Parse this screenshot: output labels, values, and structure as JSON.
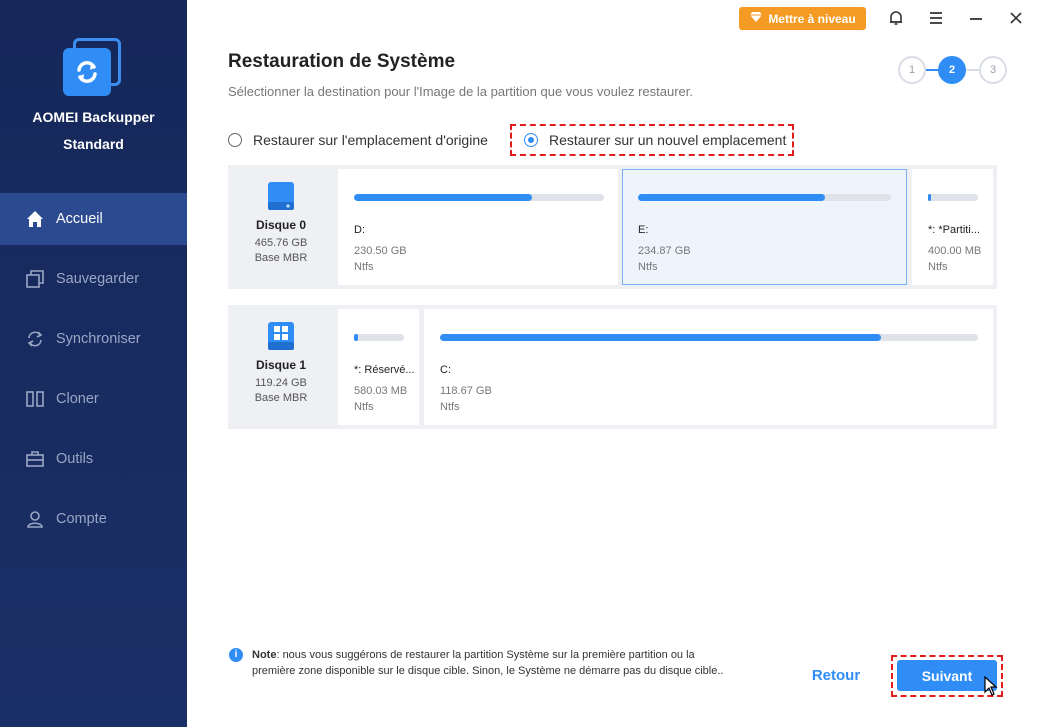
{
  "app": {
    "name": "AOMEI Backupper",
    "edition": "Standard"
  },
  "sidebar": {
    "items": [
      {
        "label": "Accueil",
        "icon": "home-icon",
        "active": true
      },
      {
        "label": "Sauvegarder",
        "icon": "backup-icon",
        "active": false
      },
      {
        "label": "Synchroniser",
        "icon": "sync-icon",
        "active": false
      },
      {
        "label": "Cloner",
        "icon": "clone-icon",
        "active": false
      },
      {
        "label": "Outils",
        "icon": "toolbox-icon",
        "active": false
      },
      {
        "label": "Compte",
        "icon": "user-icon",
        "active": false
      }
    ]
  },
  "topbar": {
    "upgrade_label": "Mettre à niveau",
    "icons": [
      "bell-icon",
      "menu-icon",
      "minimize-icon",
      "close-icon"
    ]
  },
  "page": {
    "title": "Restauration de Système",
    "subtitle": "Sélectionner la destination pour l'Image de la partition que vous voulez restaurer."
  },
  "stepper": {
    "steps": [
      "1",
      "2",
      "3"
    ],
    "current": 2
  },
  "options": {
    "original": "Restaurer sur l'emplacement d'origine",
    "new_location": "Restaurer sur un nouvel emplacement",
    "selected": "new_location"
  },
  "disks": [
    {
      "name": "Disque 0",
      "size": "465.76 GB",
      "type": "Base MBR",
      "partitions": [
        {
          "label": "D:",
          "size": "230.50 GB",
          "fs": "Ntfs",
          "used": 0.71
        },
        {
          "label": "E:",
          "size": "234.87 GB",
          "fs": "Ntfs",
          "used": 0.74,
          "selected": true
        },
        {
          "label": "*: *Partiti...",
          "size": "400.00 MB",
          "fs": "Ntfs",
          "used": 0.06
        }
      ]
    },
    {
      "name": "Disque 1",
      "size": "119.24 GB",
      "type": "Base MBR",
      "partitions": [
        {
          "label": "*: Réservé...",
          "size": "580.03 MB",
          "fs": "Ntfs",
          "used": 0.08
        },
        {
          "label": "C:",
          "size": "118.67 GB",
          "fs": "Ntfs",
          "used": 0.82
        }
      ]
    }
  ],
  "note": {
    "prefix": "Note",
    "text": ": nous vous suggérons de restaurer la partition Système sur la première partition ou la première zone disponible sur le disque cible. Sinon, le Système ne démarre pas du disque cible.."
  },
  "buttons": {
    "back": "Retour",
    "next": "Suivant"
  },
  "colors": {
    "accent": "#2f8df5",
    "sidebar": "#16285a",
    "upgrade": "#f59a23",
    "highlight": "#e21b1b"
  }
}
